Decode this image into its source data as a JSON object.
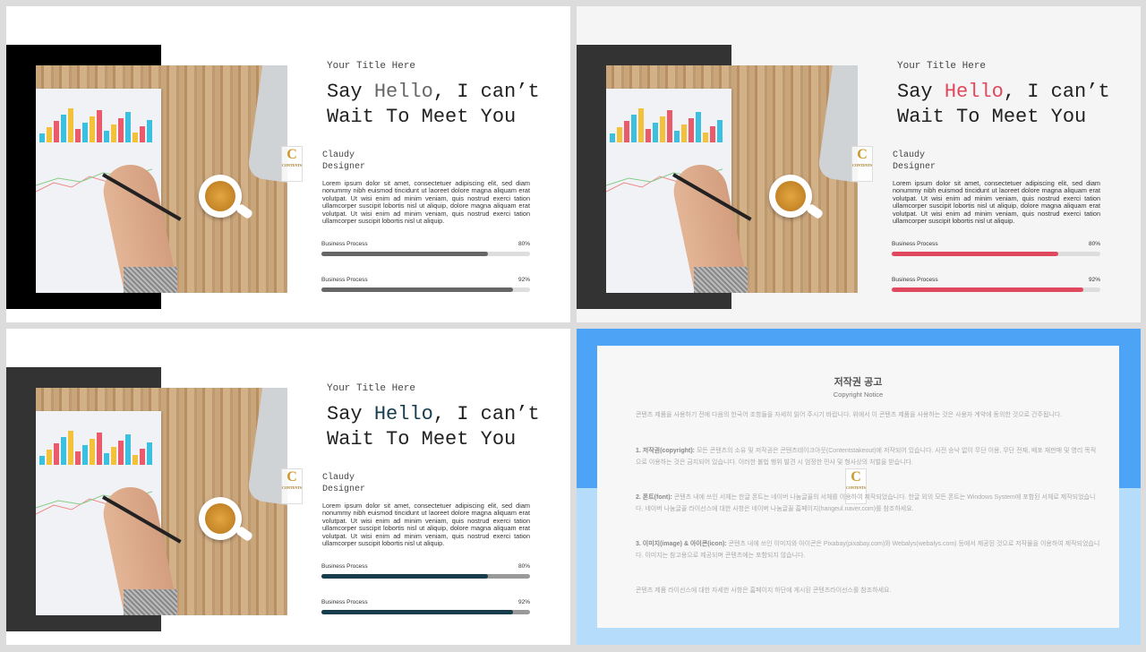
{
  "slides": [
    {
      "accent": "#666666",
      "block": "#000000",
      "small_title": "Your Title Here",
      "head_pre": "Say ",
      "head_hl": "Hello",
      "head_post": ", I can’t",
      "head2": "Wait To Meet You",
      "name": "Claudy",
      "role": "Designer",
      "lorem": "Lorem ipsum dolor sit amet, consectetuer adipiscing elit, sed diam nonummy nibh euismod tincidunt ut laoreet dolore magna aliquam erat volutpat. Ut wisi enim ad minim veniam, quis nostrud exerci tation ullamcorper suscipit lobortis nisl ut aliquip, dolore magna aliquam erat volutpat. Ut wisi enim ad minim veniam, quis nostrud exerci tation ullamcorper suscipit lobortis nisl ut aliquip.",
      "bars": [
        {
          "label": "Business Process",
          "value": 80,
          "value_text": "80%"
        },
        {
          "label": "Business Process",
          "value": 92,
          "value_text": "92%"
        }
      ],
      "logo": "C"
    },
    {
      "accent": "#e0485e",
      "block": "#333333",
      "small_title": "Your Title Here",
      "head_pre": "Say ",
      "head_hl": "Hello",
      "head_post": ", I can’t",
      "head2": "Wait To Meet You",
      "name": "Claudy",
      "role": "Designer",
      "lorem": "Lorem ipsum dolor sit amet, consectetuer adipiscing elit, sed diam nonummy nibh euismod tincidunt ut laoreet dolore magna aliquam erat volutpat. Ut wisi enim ad minim veniam, quis nostrud exerci tation ullamcorper suscipit lobortis nisl ut aliquip, dolore magna aliquam erat volutpat. Ut wisi enim ad minim veniam, quis nostrud exerci tation ullamcorper suscipit lobortis nisl ut aliquip.",
      "bars": [
        {
          "label": "Business Process",
          "value": 80,
          "value_text": "80%"
        },
        {
          "label": "Business Process",
          "value": 92,
          "value_text": "92%"
        }
      ],
      "logo": "C"
    },
    {
      "accent": "#163c4e",
      "block": "#333333",
      "small_title": "Your Title Here",
      "head_pre": "Say ",
      "head_hl": "Hello",
      "head_post": ", I can’t",
      "head2": "Wait To Meet You",
      "name": "Claudy",
      "role": "Designer",
      "lorem": "Lorem ipsum dolor sit amet, consectetuer adipiscing elit, sed diam nonummy nibh euismod tincidunt ut laoreet dolore magna aliquam erat volutpat. Ut wisi enim ad minim veniam, quis nostrud exerci tation ullamcorper suscipit lobortis nisl ut aliquip, dolore magna aliquam erat volutpat. Ut wisi enim ad minim veniam, quis nostrud exerci tation ullamcorper suscipit lobortis nisl ut aliquip.",
      "bars": [
        {
          "label": "Business Process",
          "value": 80,
          "value_text": "80%"
        },
        {
          "label": "Business Process",
          "value": 92,
          "value_text": "92%"
        }
      ],
      "logo": "C"
    }
  ],
  "copyright": {
    "title": "저작권 공고",
    "subtitle": "Copyright Notice",
    "intro": "콘텐츠 제품을 사용하기 전에 다음의 한국어 조항들을 자세히 읽어 주시기 바랍니다. 위에서 이 콘텐츠 제품을 사용하는 것은 사용자 계약에 동의한 것으로 간주됩니다.",
    "p1_label": "1. 저작권(copyright):",
    "p1": "모든 콘텐츠의 소유 및 저작권은 콘텐츠테이크아웃(Contentstakeout)에 저작되어 있습니다. 사전 승낙 없이 무단 이용, 무단 전재, 배포 재판매 및 영리 목적으로 이용하는 것은 금지되어 있습니다. 이러한 불법 행위 발견 시 엄정한 민사 및 형사상의 처벌을 받습니다.",
    "p2_label": "2. 폰트(font):",
    "p2": "콘텐츠 내에 쓰인 서체는 한글 폰트는 네이버 나눔글꼴의 서체를 이용하여 제작되었습니다. 한글 외의 모든 폰트는 Windows System에 포함된 서체로 제작되었습니다. 네이버 나눔글꼴 라이선스에 대한 사항은 네이버 나눔글꼴 홈페이지(hangeul.naver.com)를 참조하세요.",
    "p3_label": "3. 이미지(image) & 아이콘(icon):",
    "p3": "콘텐츠 내에 쓰인 이미지와 아이콘은 Pixabay(pixabay.com)와 Webalys(webalys.com) 등에서 제공된 것으로 저작물을 이용하여 제작되었습니다. 이미지는 참고용으로 제공되며 콘텐츠에는 포함되지 않습니다.",
    "outro": "콘텐츠 제품 라이선스에 대한 자세한 사항은 홈페이지 하단에 게시된 콘텐츠라이선스를 참조하세요.",
    "logo": "C",
    "colors": {
      "top": "#4da3f5",
      "bottom": "#b5dcfa"
    }
  }
}
